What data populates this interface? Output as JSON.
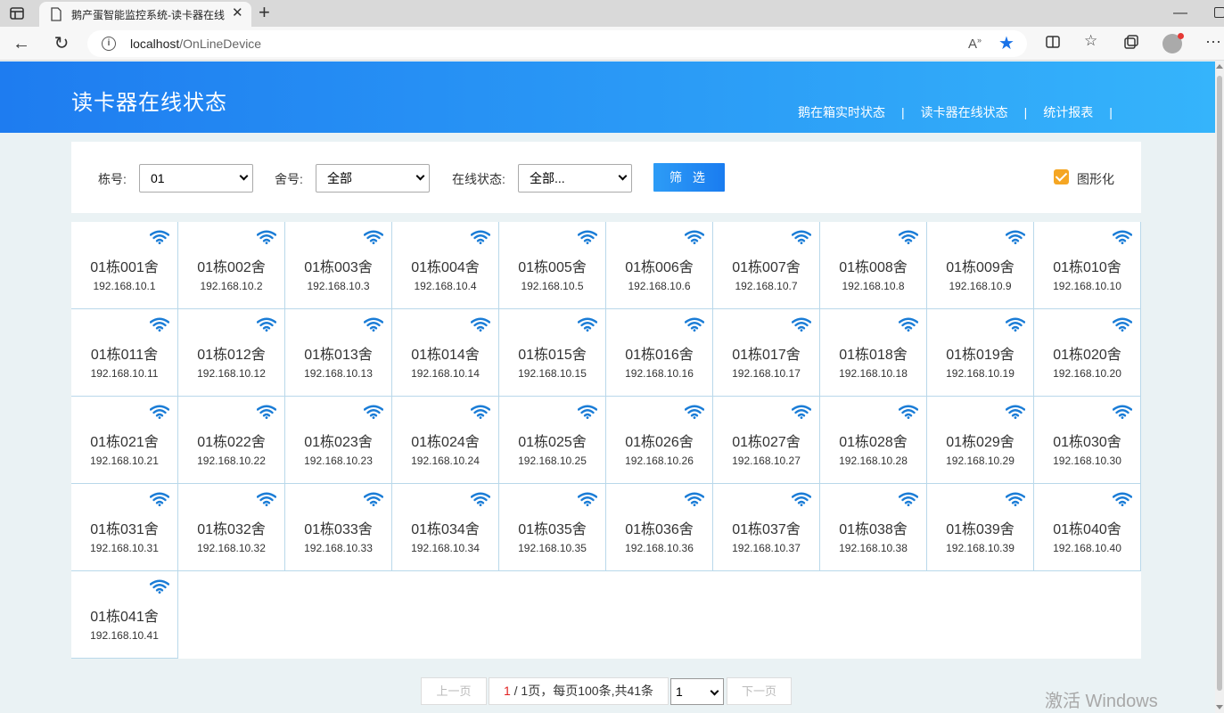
{
  "browser": {
    "tab_title": "鹅产蛋智能监控系统-读卡器在线",
    "url_host": "localhost",
    "url_path": "/OnLineDevice"
  },
  "header": {
    "title": "读卡器在线状态",
    "nav": [
      "鹅在箱实时状态",
      "读卡器在线状态",
      "统计报表"
    ],
    "separator": "|"
  },
  "filter": {
    "building_label": "栋号:",
    "building_value": "01",
    "dorm_label": "舍号:",
    "dorm_value": "全部",
    "status_label": "在线状态:",
    "status_value": "全部...",
    "filter_button": "筛 选",
    "graph_label": "图形化",
    "graph_checked": true
  },
  "devices": [
    {
      "name": "01栋001舍",
      "ip": "192.168.10.1"
    },
    {
      "name": "01栋002舍",
      "ip": "192.168.10.2"
    },
    {
      "name": "01栋003舍",
      "ip": "192.168.10.3"
    },
    {
      "name": "01栋004舍",
      "ip": "192.168.10.4"
    },
    {
      "name": "01栋005舍",
      "ip": "192.168.10.5"
    },
    {
      "name": "01栋006舍",
      "ip": "192.168.10.6"
    },
    {
      "name": "01栋007舍",
      "ip": "192.168.10.7"
    },
    {
      "name": "01栋008舍",
      "ip": "192.168.10.8"
    },
    {
      "name": "01栋009舍",
      "ip": "192.168.10.9"
    },
    {
      "name": "01栋010舍",
      "ip": "192.168.10.10"
    },
    {
      "name": "01栋011舍",
      "ip": "192.168.10.11"
    },
    {
      "name": "01栋012舍",
      "ip": "192.168.10.12"
    },
    {
      "name": "01栋013舍",
      "ip": "192.168.10.13"
    },
    {
      "name": "01栋014舍",
      "ip": "192.168.10.14"
    },
    {
      "name": "01栋015舍",
      "ip": "192.168.10.15"
    },
    {
      "name": "01栋016舍",
      "ip": "192.168.10.16"
    },
    {
      "name": "01栋017舍",
      "ip": "192.168.10.17"
    },
    {
      "name": "01栋018舍",
      "ip": "192.168.10.18"
    },
    {
      "name": "01栋019舍",
      "ip": "192.168.10.19"
    },
    {
      "name": "01栋020舍",
      "ip": "192.168.10.20"
    },
    {
      "name": "01栋021舍",
      "ip": "192.168.10.21"
    },
    {
      "name": "01栋022舍",
      "ip": "192.168.10.22"
    },
    {
      "name": "01栋023舍",
      "ip": "192.168.10.23"
    },
    {
      "name": "01栋024舍",
      "ip": "192.168.10.24"
    },
    {
      "name": "01栋025舍",
      "ip": "192.168.10.25"
    },
    {
      "name": "01栋026舍",
      "ip": "192.168.10.26"
    },
    {
      "name": "01栋027舍",
      "ip": "192.168.10.27"
    },
    {
      "name": "01栋028舍",
      "ip": "192.168.10.28"
    },
    {
      "name": "01栋029舍",
      "ip": "192.168.10.29"
    },
    {
      "name": "01栋030舍",
      "ip": "192.168.10.30"
    },
    {
      "name": "01栋031舍",
      "ip": "192.168.10.31"
    },
    {
      "name": "01栋032舍",
      "ip": "192.168.10.32"
    },
    {
      "name": "01栋033舍",
      "ip": "192.168.10.33"
    },
    {
      "name": "01栋034舍",
      "ip": "192.168.10.34"
    },
    {
      "name": "01栋035舍",
      "ip": "192.168.10.35"
    },
    {
      "name": "01栋036舍",
      "ip": "192.168.10.36"
    },
    {
      "name": "01栋037舍",
      "ip": "192.168.10.37"
    },
    {
      "name": "01栋038舍",
      "ip": "192.168.10.38"
    },
    {
      "name": "01栋039舍",
      "ip": "192.168.10.39"
    },
    {
      "name": "01栋040舍",
      "ip": "192.168.10.40"
    },
    {
      "name": "01栋041舍",
      "ip": "192.168.10.41"
    }
  ],
  "pagination": {
    "prev": "上一页",
    "current": "1",
    "info_rest": "/ 1页，每页100条,共41条",
    "page_select": "1",
    "next": "下一页"
  },
  "watermark": "激活 Windows",
  "colors": {
    "header_start": "#1e7cf0",
    "header_end": "#35b4fb",
    "wifi": "#1a7cd6",
    "checkbox": "#f5a623",
    "page_current": "#e02020"
  }
}
